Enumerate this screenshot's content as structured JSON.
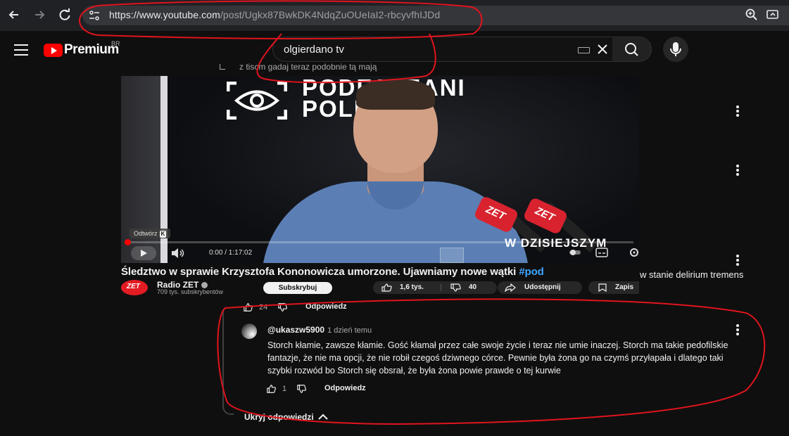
{
  "browser": {
    "url_host": "https://www.youtube.com",
    "url_path": "/post/Ugkx87BwkDK4NdqZuOUeIaI2-rbcyvfhIJDd",
    "icons": [
      "back-arrow-icon",
      "forward-arrow-icon",
      "reload-icon",
      "site-info-icon",
      "zoom-icon",
      "cast-icon"
    ]
  },
  "masthead": {
    "logo_text": "Premium",
    "logo_country": "BR",
    "search_value": "olgierdano tv",
    "brand_color": "#ff0000"
  },
  "background_comment": {
    "partial_text": "z tiscm gadaj teraz podobnie tą mają",
    "overflow_text": "w stanie delirium tremens"
  },
  "video": {
    "player_brand_line1": "PODEJRZANI",
    "player_brand_line2": "POLICY",
    "mic_label": "ZET",
    "lower_third": "W DZISIEJSZYM",
    "play_tooltip": "Odtwórz",
    "play_tooltip_key": "K",
    "time": "0:00 / 1:17:02",
    "progress_fraction": 0.0,
    "title": "Śledztwo w sprawie Krzysztofa Kononowicza umorzone. Ujawniamy nowe wątki ",
    "hashtag": "#pod",
    "channel_name": "Radio ZET",
    "channel_avatar_text": "ZET",
    "channel_subs": "709 tys. subskrybentów",
    "subscribe_label": "Subskrybuj",
    "likes": "1,6 tys.",
    "dislikes": "40",
    "share_label": "Udostępnij",
    "save_label": "Zapis"
  },
  "parent_actions": {
    "likes": "24",
    "reply_label": "Odpowiedz"
  },
  "reply": {
    "author": "@ukaszw5900",
    "time": "1 dzień temu",
    "text": "Storch kłamie, zawsze kłamie. Gość kłamał przez całe swoje życie i teraz nie umie inaczej. Storch ma takie pedofilskie fantazje, że nie ma opcji, że nie robił czegoś dziwnego córce. Pewnie była żona go na czymś przyłapała i dlatego taki szybki rozwód bo Storch się obsrał, że była żona powie prawde o tej kurwie",
    "likes": "1",
    "reply_label": "Odpowiedz"
  },
  "hide_replies_label": "Ukryj odpowiedzi",
  "annotation_color": "#e0141e"
}
